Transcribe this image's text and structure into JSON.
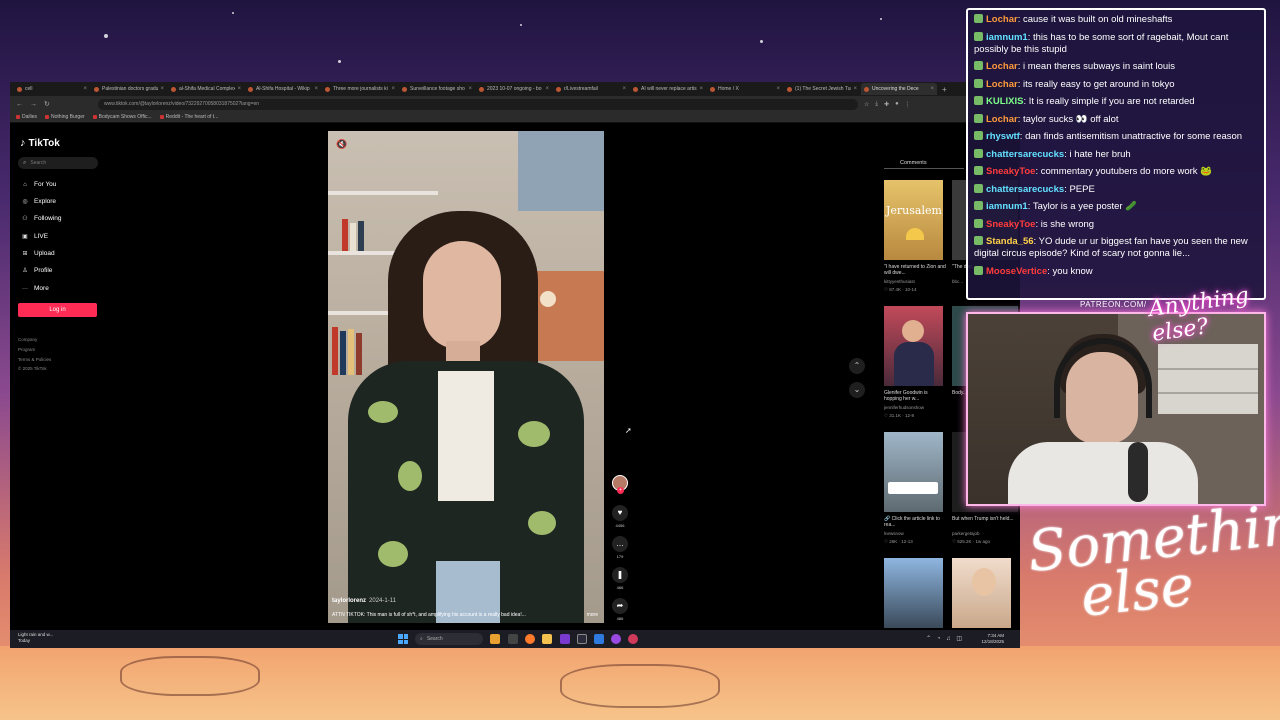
{
  "browser": {
    "tabs": [
      {
        "label": "cell"
      },
      {
        "label": "Palestinian doctors gradu"
      },
      {
        "label": "al-Shifa Medical Complex"
      },
      {
        "label": "Al-Shifa Hospital - Wikip"
      },
      {
        "label": "Three more journalists ki"
      },
      {
        "label": "Surveillance footage sho"
      },
      {
        "label": "2023 10-07 ongoing - bo"
      },
      {
        "label": "r/Livestreamfail"
      },
      {
        "label": "AI will never replace artis"
      },
      {
        "label": "Home / X"
      },
      {
        "label": "(1) The Secret Jewish Tun"
      },
      {
        "label": "Uncovering the Dece"
      }
    ],
    "new_tab": "+",
    "url": "www.tiktok.com/@taylorlorenz/video/7322927005803187502?lang=en",
    "bookmarks": [
      "Dailies",
      "Nothing Burger",
      "Bodycam Shows Offic...",
      "Reddit - The heart of t..."
    ]
  },
  "tiktok": {
    "logo": "TikTok",
    "search_placeholder": "Search",
    "nav": [
      {
        "label": "For You",
        "icon": "home-icon"
      },
      {
        "label": "Explore",
        "icon": "compass-icon"
      },
      {
        "label": "Following",
        "icon": "users-icon"
      },
      {
        "label": "LIVE",
        "icon": "live-icon"
      },
      {
        "label": "Upload",
        "icon": "upload-icon"
      },
      {
        "label": "Profile",
        "icon": "user-icon"
      },
      {
        "label": "More",
        "icon": "more-icon"
      }
    ],
    "login_label": "Log in",
    "footer": [
      "Company",
      "Program",
      "Terms & Policies",
      "© 2025 TikTok"
    ],
    "video": {
      "author": "taylorlorenz",
      "date": "2024-1-11",
      "caption": "ATTN TIKTOK: This man is full of sh*t, and amplifying his account is a really bad idea!...",
      "more": "more"
    },
    "actions": [
      {
        "name": "like",
        "icon": "heart-icon",
        "glyph": "♥",
        "count": "4456"
      },
      {
        "name": "comment",
        "icon": "comment-icon",
        "glyph": "…",
        "count": "179"
      },
      {
        "name": "save",
        "icon": "bookmark-icon",
        "glyph": "❚",
        "count": "466"
      },
      {
        "name": "share",
        "icon": "share-icon",
        "glyph": "➦",
        "count": "486"
      }
    ],
    "comments_tab": "Comments",
    "related": [
      {
        "caption": "\"I have returned to Zion and will dwe...",
        "user": "kittyyenthusiast",
        "meta": "♡ 87.4K · 10-14",
        "thumb_text": "Jerusalem"
      },
      {
        "caption": "\"The disc...",
        "user": "bbc...",
        "meta": "",
        "thumb_text": ""
      },
      {
        "caption": "Glenifer Goodwin is hopping her w...",
        "user": "jenniferhudsonshow",
        "meta": "♡ 31.1K · 12-8",
        "thumb_text": ""
      },
      {
        "caption": "Body... show...",
        "user": "",
        "meta": "",
        "thumb_text": ""
      },
      {
        "caption": "🔗 Click the article link to rea...",
        "user": "lnewsnow",
        "meta": "♡ 26K · 12-13",
        "thumb_text": ""
      },
      {
        "caption": "But when Trump isn't held...",
        "user": "parkergetajob",
        "meta": "♡ 625.2K · 1w ago",
        "thumb_text": ""
      },
      {
        "caption": "",
        "user": "",
        "meta": "",
        "thumb_text": ""
      },
      {
        "caption": "",
        "user": "",
        "meta": "",
        "thumb_text": ""
      }
    ]
  },
  "taskbar": {
    "weather_line1": "Light rain and w...",
    "weather_line2": "Today",
    "search_placeholder": "Search",
    "time": "7:34 AM",
    "date": "12/18/2025"
  },
  "chat": [
    {
      "user": "Lochar",
      "color": "#ff9a3c",
      "text": "cause it was built on old mineshafts"
    },
    {
      "user": "iamnum1",
      "color": "#62e0ff",
      "text": "this has to be some sort of ragebait, Mout cant possibly be this stupid"
    },
    {
      "user": "Lochar",
      "color": "#ff9a3c",
      "text": "i mean theres subways in saint louis"
    },
    {
      "user": "Lochar",
      "color": "#ff9a3c",
      "text": "its really easy to get around in tokyo"
    },
    {
      "user": "KULIXIS",
      "color": "#7cff8a",
      "text": "It is really simple if you are not retarded"
    },
    {
      "user": "Lochar",
      "color": "#ff9a3c",
      "text": "taylor sucks 👀 off alot"
    },
    {
      "user": "rhyswtf",
      "color": "#62e0ff",
      "text": "dan finds antisemitism unattractive for some reason"
    },
    {
      "user": "chattersarecucks",
      "color": "#62e0ff",
      "text": "i hate her bruh"
    },
    {
      "user": "SneakyToe",
      "color": "#ff3c3c",
      "text": "commentary youtubers do more work 🐸"
    },
    {
      "user": "chattersarecucks",
      "color": "#62e0ff",
      "text": "PEPE"
    },
    {
      "user": "iamnum1",
      "color": "#62e0ff",
      "text": "Taylor is a yee poster 🥒"
    },
    {
      "user": "SneakyToe",
      "color": "#ff3c3c",
      "text": "is she wrong"
    },
    {
      "user": "Standa_56",
      "color": "#ffd24a",
      "text": "YO dude ur ur biggest fan have you seen the new digital circus episode? Kind of scary not gonna lie..."
    },
    {
      "user": "MooseVertice",
      "color": "#ff3c3c",
      "text": "you know"
    }
  ],
  "overlay": {
    "patreon": "PATREON.COM/",
    "cam_logo": "Anything else?",
    "brand_line1": "Something",
    "brand_line2": "else"
  }
}
